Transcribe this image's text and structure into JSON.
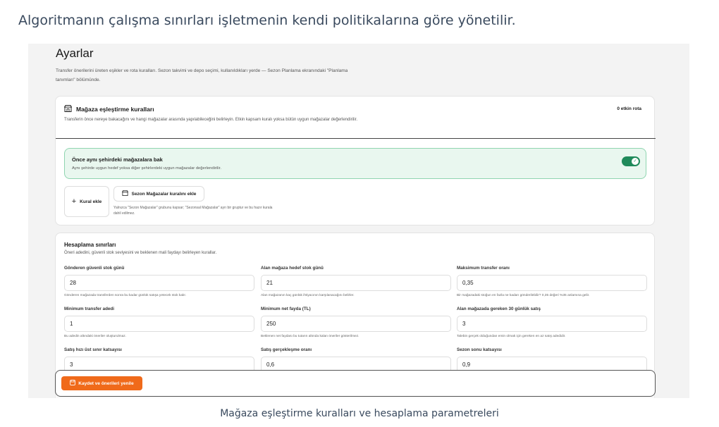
{
  "captions": {
    "top": "Algoritmanın çalışma sınırları işletmenin kendi politikalarına göre yönetilir.",
    "bottom": "Mağaza eşleştirme kuralları ve hesaplama parametreleri"
  },
  "page": {
    "title": "Ayarlar",
    "description": "Transfer önerilerini üreten eşikler ve rota kuralları. Sezon takvimi ve depo seçimi, kullanıldıkları yerde — Sezon Planlama ekranındaki \"Planlama tanımları\" bölümünde."
  },
  "matching": {
    "title": "Mağaza eşleştirme kuralları",
    "icon": "store-icon",
    "subtitle": "Transferin önce nereye bakacağını ve hangi mağazalar arasında yapılabileceğini belirleyin. Etkin kapsam kuralı yoksa bütün uygun mağazalar değerlendirilir.",
    "active_count": "0 etkin rota",
    "rule": {
      "title": "Önce aynı şehirdeki mağazalara bak",
      "subtitle": "Aynı şehirde uygun hedef yoksa diğer şehirlerdeki uygun mağazalar değerlendirilir.",
      "enabled": true,
      "toggle_color": "#1f8a5a"
    },
    "add_rule_label": "Kural ekle",
    "season_button_label": "Sezon Mağazalar kuralını ekle",
    "season_note": "Yalnızca \"Sezon Mağazalar\" grubunu kapsar; \"Sezonsal Mağazalar\" ayrı bir gruptur ve bu hazır kurala dahil edilmez."
  },
  "limits": {
    "title": "Hesaplama sınırları",
    "subtitle": "Öneri adedini, güvenli stok seviyesini ve beklenen mali faydayı belirleyen kurallar.",
    "fields": [
      {
        "label": "Gönderen güvenli stok günü",
        "value": "28",
        "hint": "Gönderen mağazada transferden sonra bu kadar günlük satışa yetecek stok kalır."
      },
      {
        "label": "Alan mağaza hedef stok günü",
        "value": "21",
        "hint": "Alan mağazanın kaç günlük ihtiyacının karşılanacağını belirler."
      },
      {
        "label": "Maksimum transfer oranı",
        "value": "0,35",
        "hint": "Bir mağazadaki stoğun en fazla ne kadarı gönderilebilir? 0,35 değeri %35 anlamına gelir."
      },
      {
        "label": "Minimum transfer adedi",
        "value": "1",
        "hint": "Bu adedin altındaki öneriler oluşturulmaz."
      },
      {
        "label": "Minimum net fayda (TL)",
        "value": "250",
        "hint": "Beklenen net faydası bu tutarın altında kalan öneriler gösterilmez."
      },
      {
        "label": "Alan mağazada gereken 30 günlük satış",
        "value": "3",
        "hint": "Talebin gerçek olduğundan emin olmak için gereken en az satış adedidir."
      },
      {
        "label": "Satış hızı üst sınır katsayısı",
        "value": "3",
        "hint": ""
      },
      {
        "label": "Satış gerçekleşme oranı",
        "value": "0,6",
        "hint": ""
      },
      {
        "label": "Sezon sonu katsayısı",
        "value": "0,9",
        "hint": ""
      }
    ]
  },
  "savebar": {
    "save_label": "Kaydet ve önerileri yenile",
    "icon": "save-icon",
    "accent": "#f06a1a"
  }
}
